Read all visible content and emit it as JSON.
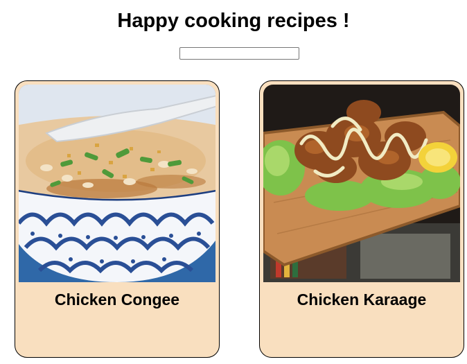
{
  "header": {
    "title": "Happy cooking recipes !"
  },
  "search": {
    "value": "",
    "placeholder": ""
  },
  "recipes": [
    {
      "name": "Chicken Congee",
      "image": "congee-bowl-photo"
    },
    {
      "name": "Chicken Karaage",
      "image": "karaage-plate-photo"
    }
  ],
  "colors": {
    "card_background": "#f9dfbf",
    "card_border": "#000000"
  }
}
